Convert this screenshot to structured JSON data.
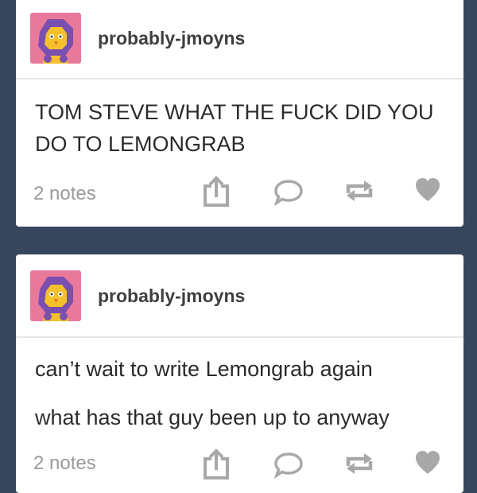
{
  "posts": [
    {
      "username": "probably-jmoyns",
      "paragraphs": [
        "TOM STEVE WHAT THE FUCK DID YOU DO TO LEMONGRAB"
      ],
      "notes": "2 notes"
    },
    {
      "username": "probably-jmoyns",
      "paragraphs": [
        "can’t wait to write Lemongrab again",
        "what has that guy been up to anyway"
      ],
      "notes": "2 notes"
    }
  ],
  "icons": {
    "share": "share-icon",
    "reply": "reply-icon",
    "reblog": "reblog-icon",
    "like": "heart-icon"
  },
  "colors": {
    "dashboard_bg": "#36465d",
    "card_bg": "#ffffff",
    "muted_gray": "#9a9a9a",
    "avatar_pink": "#e9799b",
    "avatar_purple": "#7b4fb0",
    "avatar_yellow": "#f4c12a"
  }
}
